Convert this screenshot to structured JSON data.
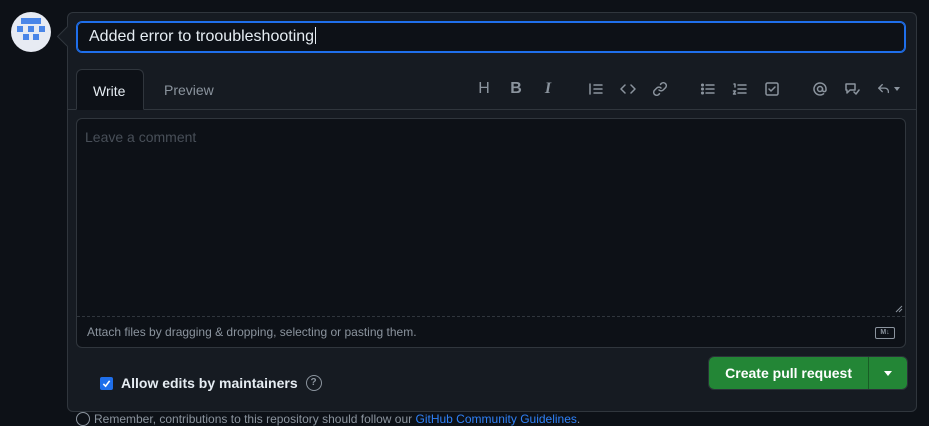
{
  "title_value": "Added error to trooubleshooting",
  "tabs": {
    "write": "Write",
    "preview": "Preview"
  },
  "toolbar_icons": [
    "heading-icon",
    "bold-icon",
    "italic-icon",
    "quote-icon",
    "code-icon",
    "link-icon",
    "unordered-list-icon",
    "ordered-list-icon",
    "task-list-icon",
    "mention-icon",
    "reference-icon",
    "reply-icon"
  ],
  "toolbar": {
    "heading": "H",
    "bold": "B",
    "italic": "I"
  },
  "editor": {
    "placeholder": "Leave a comment",
    "attach_text": "Attach files by dragging & dropping, selecting or pasting them.",
    "markdown_badge": "M↓"
  },
  "allow_edits": {
    "label": "Allow edits by maintainers",
    "checked": true,
    "help": "?"
  },
  "create_button": {
    "label": "Create pull request"
  },
  "footer": {
    "prefix": "Remember, contributions to this repository should follow our ",
    "link": "GitHub Community Guidelines",
    "suffix": "."
  },
  "colors": {
    "accent": "#1f6feb",
    "primary_button": "#238636",
    "background": "#0d1117"
  }
}
